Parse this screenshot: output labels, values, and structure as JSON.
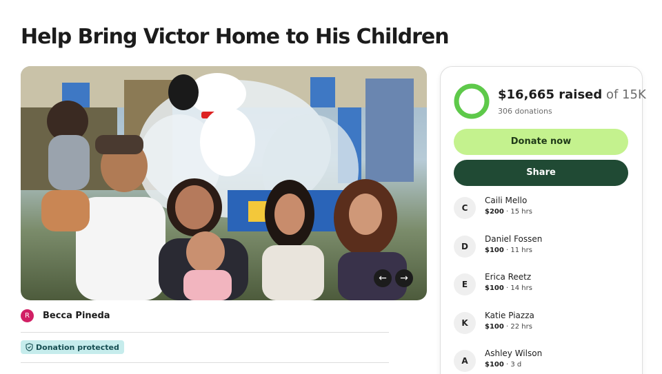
{
  "page_title": "Help Bring Victor Home to His Children",
  "photo": {
    "alt": "",
    "prev_icon": "←",
    "next_icon": "→",
    "slides": 2,
    "active_slide": 1
  },
  "organizer": {
    "initial": "R",
    "name": "Becca Pineda",
    "avatar_color": "#d11f64"
  },
  "badge": {
    "label": "Donation protected",
    "icon": "shield-icon"
  },
  "progress": {
    "raised_amount": "$16,665 raised",
    "goal_text": " of 15K",
    "donations_count": "306 donations",
    "fraction": 1.0,
    "ring_color": "#5ec94a"
  },
  "buttons": {
    "donate": "Donate now",
    "share": "Share",
    "donate_color": "#c4f28e",
    "share_color": "#204a34"
  },
  "donors": [
    {
      "initial": "C",
      "name": "Caili Mello",
      "amount": "$200",
      "time": " · 15 hrs"
    },
    {
      "initial": "D",
      "name": "Daniel Fossen",
      "amount": "$100",
      "time": " · 11 hrs"
    },
    {
      "initial": "E",
      "name": "Erica Reetz",
      "amount": "$100",
      "time": " · 14 hrs"
    },
    {
      "initial": "K",
      "name": "Katie Piazza",
      "amount": "$100",
      "time": " · 22 hrs"
    },
    {
      "initial": "A",
      "name": "Ashley Wilson",
      "amount": "$100",
      "time": " · 3 d"
    }
  ]
}
